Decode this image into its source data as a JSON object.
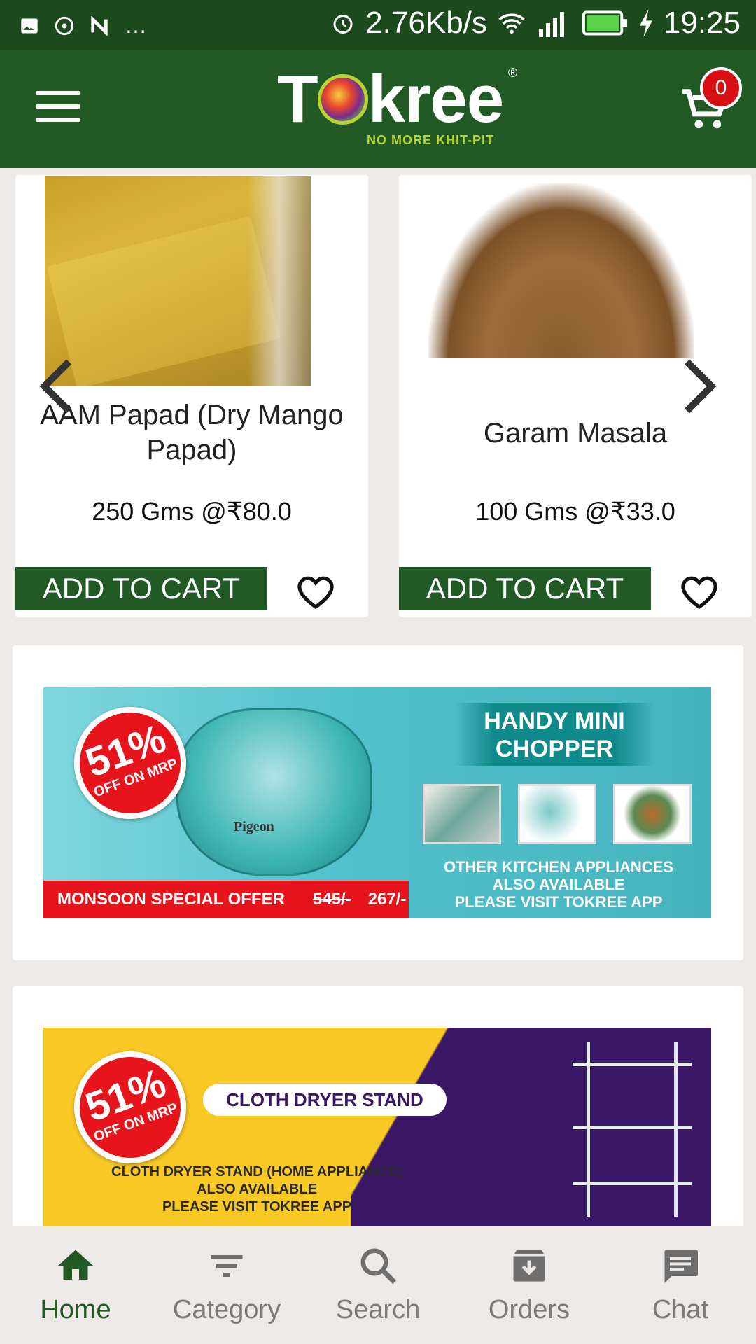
{
  "status_bar": {
    "net_speed": "2.76Kb/s",
    "time": "19:25",
    "more": "…"
  },
  "header": {
    "logo_left": "T",
    "logo_right": "kree",
    "logo_reg": "®",
    "tagline": "NO MORE KHIT-PIT",
    "cart_count": "0"
  },
  "products": [
    {
      "name": "AAM Papad (Dry Mango Papad)",
      "price": "250 Gms @₹80.0",
      "add_label": "ADD TO CART"
    },
    {
      "name": "Garam Masala",
      "price": "100 Gms @₹33.0",
      "add_label": "ADD TO CART"
    }
  ],
  "banners": [
    {
      "badge_pct": "51%",
      "badge_off": "OFF ON MRP",
      "title_line1": "HANDY MINI",
      "title_line2": "CHOPPER",
      "brand": "Pigeon",
      "offer_label": "MONSOON SPECIAL OFFER",
      "old_price": "545/-",
      "new_price": "267/-",
      "sub_line1": "OTHER KITCHEN APPLIANCES",
      "sub_line2": "ALSO AVAILABLE",
      "sub_line3": "PLEASE VISIT TOKREE APP"
    },
    {
      "badge_pct": "51%",
      "badge_off": "OFF ON MRP",
      "title": "CLOTH DRYER STAND",
      "sub_line1": "CLOTH DRYER STAND (HOME APPLIANCE)",
      "sub_line2": "ALSO AVAILABLE",
      "sub_line3": "PLEASE VISIT TOKREE APP"
    }
  ],
  "nav": [
    {
      "label": "Home",
      "icon": "home-icon"
    },
    {
      "label": "Category",
      "icon": "filter-icon"
    },
    {
      "label": "Search",
      "icon": "search-icon"
    },
    {
      "label": "Orders",
      "icon": "archive-icon"
    },
    {
      "label": "Chat",
      "icon": "chat-icon"
    }
  ],
  "colors": {
    "primary": "#215a24",
    "status_bar": "#1c4a1d",
    "badge_red": "#d80f12",
    "nav_inactive": "#7a7a7a"
  }
}
